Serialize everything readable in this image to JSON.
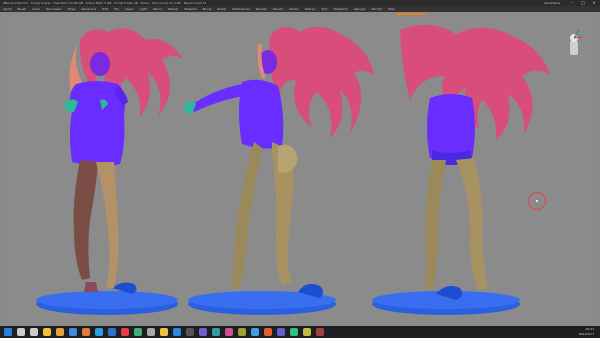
{
  "window": {
    "title": "ZBrush 2021.6.6 · Sculpt Scene · Free Mem 10.06 GB · Active Mem 3 GB · Scratch Disk 48 · Timer · Poly Count 21.2 Mil · Mesh Count 47",
    "right_label": "QuickSave"
  },
  "menu": {
    "items": [
      "Alpha",
      "Brush",
      "Color",
      "Document",
      "Draw",
      "Dynamics",
      "Edit",
      "File",
      "Layer",
      "Light",
      "Macro",
      "Marker",
      "Material",
      "Movie",
      "Picker",
      "Preferences",
      "Render",
      "Stencil",
      "Stroke",
      "Texture",
      "Tool",
      "Transform",
      "Zplugin",
      "Zscript",
      "Help"
    ]
  },
  "progress": {
    "value": 0.55,
    "color": "#e8821e"
  },
  "viewport": {
    "background": "#8b8b8b",
    "figures": [
      "figure-front-view",
      "figure-side-view",
      "figure-back-view"
    ]
  },
  "colors": {
    "shirt": "#6a2dff",
    "hair": "#d94d7a",
    "skin": "#c08a6a",
    "legs_front": "#7a4e46",
    "legs_mid": "#9a8a5a",
    "base": "#2a5fe0",
    "glove": "#2fb89a"
  },
  "taskbar": {
    "icons": [
      "windows-icon",
      "search-icon",
      "task-view-icon",
      "explorer-icon",
      "browser-icon",
      "mail-icon",
      "zbrush-icon",
      "store-icon",
      "photoshop-icon",
      "media-icon",
      "chat-icon",
      "settings-icon",
      "folder-icon",
      "edge-icon",
      "terminal-icon",
      "app-icon",
      "app2-icon",
      "app3-icon",
      "app4-icon",
      "app5-icon",
      "app6-icon",
      "app7-icon",
      "app8-icon",
      "app9-icon",
      "app10-icon"
    ],
    "time": "10:31",
    "date": "2021/4/17"
  }
}
